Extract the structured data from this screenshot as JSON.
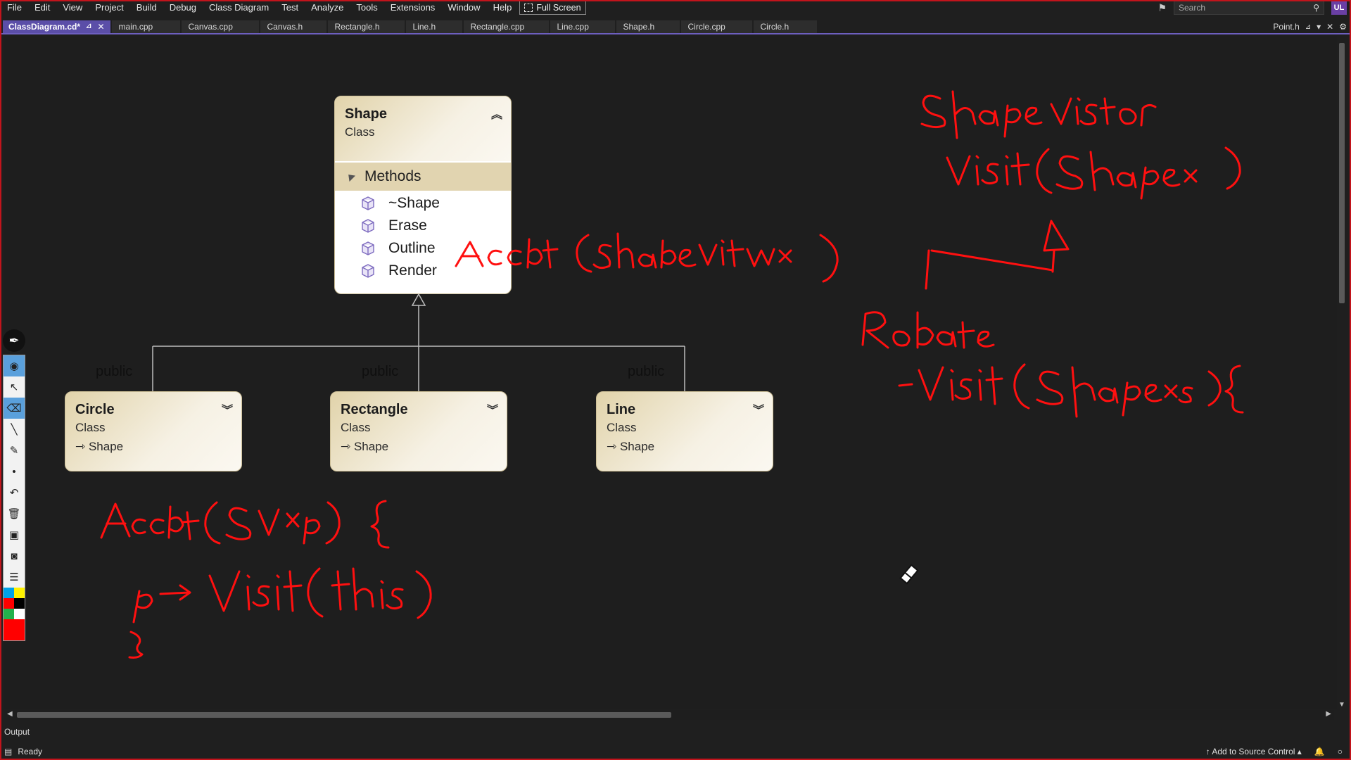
{
  "menu": [
    "File",
    "Edit",
    "View",
    "Project",
    "Build",
    "Debug",
    "Class Diagram",
    "Test",
    "Analyze",
    "Tools",
    "Extensions",
    "Window",
    "Help"
  ],
  "fullscreen_label": "Full Screen",
  "search_placeholder": "Search",
  "user_initials": "UL",
  "tabs": {
    "active": "ClassDiagram.cd*",
    "others": [
      "main.cpp",
      "Canvas.cpp",
      "Canvas.h",
      "Rectangle.h",
      "Line.h",
      "Rectangle.cpp",
      "Line.cpp",
      "Shape.h",
      "Circle.cpp",
      "Circle.h"
    ],
    "right": "Point.h"
  },
  "diagram": {
    "base": {
      "name": "Shape",
      "kind": "Class",
      "section": "Methods",
      "methods": [
        "~Shape",
        "Erase",
        "Outline",
        "Render"
      ]
    },
    "derived": [
      {
        "name": "Circle",
        "kind": "Class",
        "base": "Shape",
        "inheritance": "public"
      },
      {
        "name": "Rectangle",
        "kind": "Class",
        "base": "Shape",
        "inheritance": "public"
      },
      {
        "name": "Line",
        "kind": "Class",
        "base": "Shape",
        "inheritance": "public"
      }
    ]
  },
  "ink_colors": [
    "#00a2e8",
    "#fff200",
    "#ff0000",
    "#000000",
    "#22b14c",
    "#ffffff"
  ],
  "active_ink_color": "#ff0000",
  "output_label": "Output",
  "status": {
    "left": "Ready",
    "source_control": "Add to Source Control"
  }
}
